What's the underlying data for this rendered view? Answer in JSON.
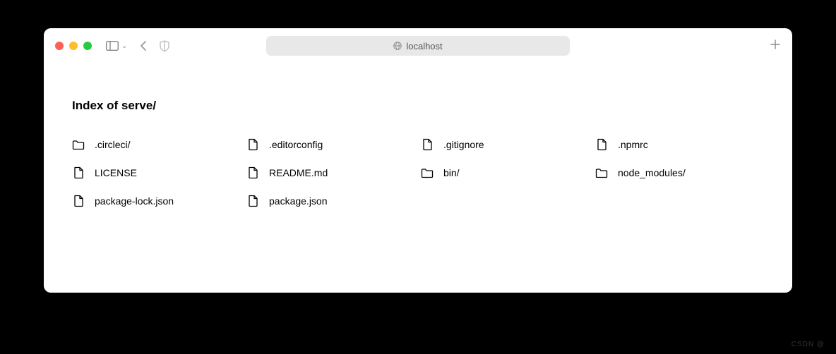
{
  "toolbar": {
    "address": "localhost"
  },
  "page": {
    "title": "Index of  serve/"
  },
  "files": [
    {
      "name": ".circleci/",
      "type": "folder"
    },
    {
      "name": ".editorconfig",
      "type": "file"
    },
    {
      "name": ".gitignore",
      "type": "file"
    },
    {
      "name": ".npmrc",
      "type": "file"
    },
    {
      "name": "LICENSE",
      "type": "file"
    },
    {
      "name": "README.md",
      "type": "file"
    },
    {
      "name": "bin/",
      "type": "folder"
    },
    {
      "name": "node_modules/",
      "type": "folder"
    },
    {
      "name": "package-lock.json",
      "type": "file"
    },
    {
      "name": "package.json",
      "type": "file"
    }
  ],
  "watermark": "CSDN @"
}
